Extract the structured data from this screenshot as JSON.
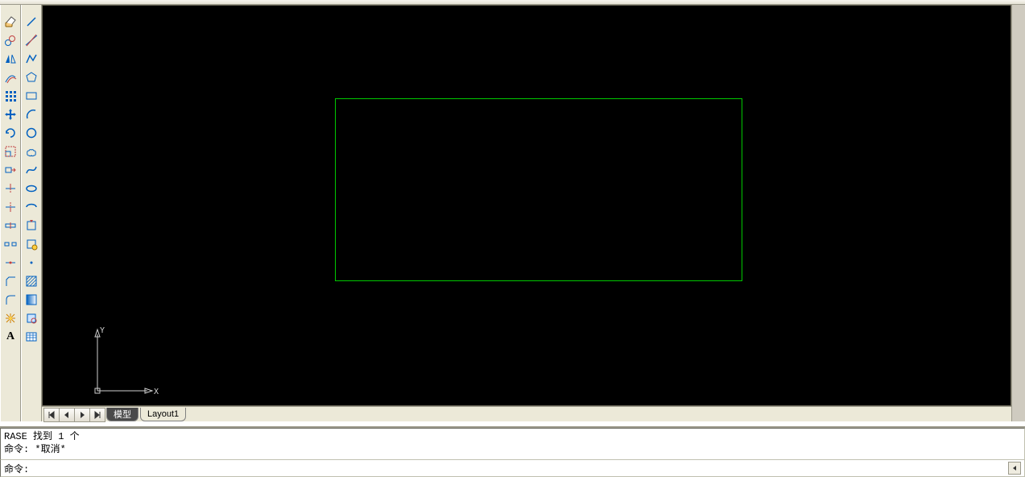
{
  "toolbar_left": [
    {
      "name": "erase-icon",
      "title": "Erase"
    },
    {
      "name": "copy-icon",
      "title": "Copy"
    },
    {
      "name": "mirror-icon",
      "title": "Mirror"
    },
    {
      "name": "offset-icon",
      "title": "Offset"
    },
    {
      "name": "array-icon",
      "title": "Array"
    },
    {
      "name": "move-icon",
      "title": "Move"
    },
    {
      "name": "rotate-icon",
      "title": "Rotate"
    },
    {
      "name": "scale-icon",
      "title": "Scale"
    },
    {
      "name": "stretch-icon",
      "title": "Stretch"
    },
    {
      "name": "trim-icon",
      "title": "Trim"
    },
    {
      "name": "extend-icon",
      "title": "Extend"
    },
    {
      "name": "break-point-icon",
      "title": "Break at Point"
    },
    {
      "name": "break-icon",
      "title": "Break"
    },
    {
      "name": "join-icon",
      "title": "Join"
    },
    {
      "name": "chamfer-icon",
      "title": "Chamfer"
    },
    {
      "name": "fillet-icon",
      "title": "Fillet"
    },
    {
      "name": "explode-icon",
      "title": "Explode"
    },
    {
      "name": "text-icon",
      "title": "Text",
      "letter": "A"
    }
  ],
  "toolbar_right": [
    {
      "name": "line-icon",
      "title": "Line"
    },
    {
      "name": "construction-line-icon",
      "title": "Construction Line"
    },
    {
      "name": "polyline-icon",
      "title": "Polyline"
    },
    {
      "name": "polygon-icon",
      "title": "Polygon"
    },
    {
      "name": "rectangle-icon",
      "title": "Rectangle"
    },
    {
      "name": "arc-icon",
      "title": "Arc"
    },
    {
      "name": "circle-icon",
      "title": "Circle"
    },
    {
      "name": "revision-cloud-icon",
      "title": "Revision Cloud"
    },
    {
      "name": "spline-icon",
      "title": "Spline"
    },
    {
      "name": "ellipse-icon",
      "title": "Ellipse"
    },
    {
      "name": "ellipse-arc-icon",
      "title": "Ellipse Arc"
    },
    {
      "name": "insert-block-icon",
      "title": "Insert Block"
    },
    {
      "name": "make-block-icon",
      "title": "Make Block"
    },
    {
      "name": "point-icon",
      "title": "Point"
    },
    {
      "name": "hatch-icon",
      "title": "Hatch"
    },
    {
      "name": "gradient-icon",
      "title": "Gradient"
    },
    {
      "name": "region-icon",
      "title": "Region"
    },
    {
      "name": "table-icon",
      "title": "Table"
    }
  ],
  "ucs": {
    "x_label": "X",
    "y_label": "Y"
  },
  "tabs": {
    "model": "模型",
    "layout1": "Layout1"
  },
  "command_history": {
    "line1": "RASE 找到 1 个",
    "line2": "命令: *取消*"
  },
  "command_prompt": "命令: ",
  "command_value": "",
  "drawing": {
    "object": "rectangle",
    "stroke_color": "#00c800"
  }
}
